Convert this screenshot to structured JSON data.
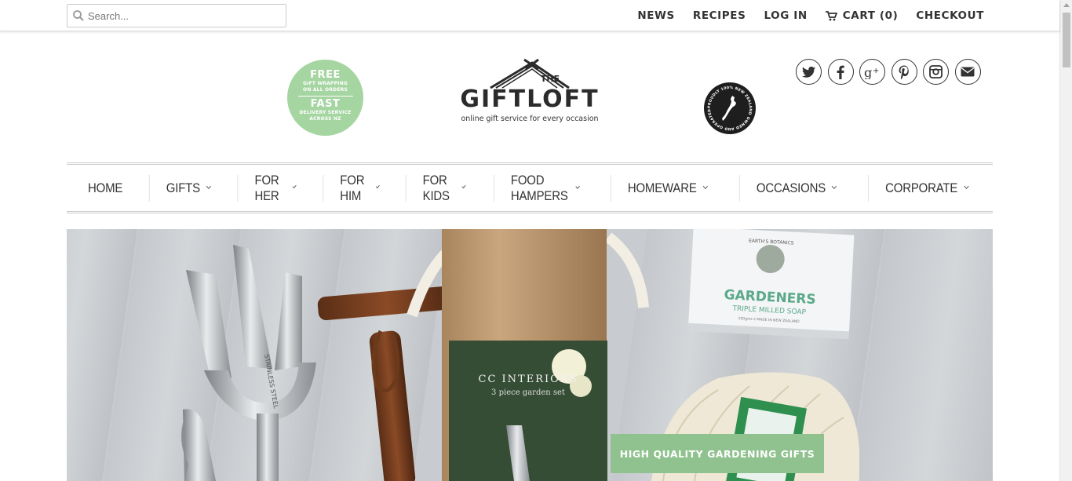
{
  "search": {
    "placeholder": "Search..."
  },
  "topnav": {
    "news": "NEWS",
    "recipes": "RECIPES",
    "login": "LOG IN",
    "cart": "CART (0)",
    "checkout": "CHECKOUT"
  },
  "badge_free": {
    "line1": "FREE",
    "line2": "GIFT WRAPPING",
    "line3": "ON ALL ORDERS",
    "line4": "FAST",
    "line5": "DELIVERY SERVICE",
    "line6": "ACROSS NZ"
  },
  "logo": {
    "the": "THE",
    "brand": "GIFTLOFT",
    "tagline": "online gift service for every occasion"
  },
  "badge_nz": {
    "text": "PROUDLY 100% NEW ZEALAND OWNED AND OPERATED"
  },
  "social": [
    "twitter-icon",
    "facebook-icon",
    "google-plus-icon",
    "pinterest-icon",
    "instagram-icon",
    "email-icon"
  ],
  "mainnav": {
    "items": [
      {
        "label": "HOME"
      },
      {
        "label": "GIFTS"
      },
      {
        "label": "FOR HER"
      },
      {
        "label": "FOR HIM"
      },
      {
        "label": "FOR KIDS"
      },
      {
        "label": "FOOD HAMPERS"
      },
      {
        "label": "HOMEWARE"
      },
      {
        "label": "OCCASIONS"
      },
      {
        "label": "CORPORATE"
      }
    ]
  },
  "hero": {
    "cta": "HIGH QUALITY GARDENING GIFTS",
    "tube_label_title": "CC INTERIORS",
    "tube_label_sub": "3 piece garden set",
    "soap_brand": "EARTH'S BOTANICS",
    "soap_name": "GARDENERS",
    "soap_sub": "TRIPLE MILLED SOAP",
    "soap_fine": "100gms e  MADE IN NEW ZEALAND",
    "fork_text": "STAINLESS STEEL"
  },
  "colors": {
    "accent_green": "#8fc28e",
    "badge_green": "#a5d5a1",
    "text_dark": "#333333"
  }
}
